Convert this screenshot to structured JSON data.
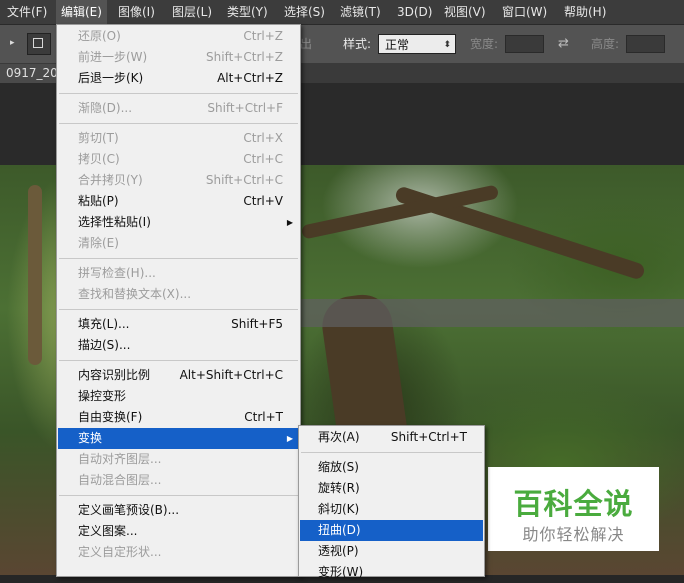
{
  "menubar": {
    "items": [
      "文件(F)",
      "编辑(E)",
      "图像(I)",
      "图层(L)",
      "类型(Y)",
      "选择(S)",
      "滤镜(T)",
      "3D(D)",
      "视图(V)",
      "窗口(W)",
      "帮助(H)"
    ],
    "active": "编辑(E)"
  },
  "options_bar": {
    "partial_label": "出",
    "style_label": "样式:",
    "style_value": "正常",
    "width_label": "宽度:",
    "height_label": "高度:",
    "swap_icon": "swap-arrows-icon"
  },
  "document_tab": {
    "title": "0917_20"
  },
  "edit_menu": {
    "groups": [
      [
        {
          "label": "还原(O)",
          "shortcut": "Ctrl+Z",
          "disabled": true
        },
        {
          "label": "前进一步(W)",
          "shortcut": "Shift+Ctrl+Z",
          "disabled": true
        },
        {
          "label": "后退一步(K)",
          "shortcut": "Alt+Ctrl+Z",
          "disabled": false
        }
      ],
      [
        {
          "label": "渐隐(D)...",
          "shortcut": "Shift+Ctrl+F",
          "disabled": true
        }
      ],
      [
        {
          "label": "剪切(T)",
          "shortcut": "Ctrl+X",
          "disabled": true
        },
        {
          "label": "拷贝(C)",
          "shortcut": "Ctrl+C",
          "disabled": true
        },
        {
          "label": "合并拷贝(Y)",
          "shortcut": "Shift+Ctrl+C",
          "disabled": true
        },
        {
          "label": "粘贴(P)",
          "shortcut": "Ctrl+V",
          "disabled": false
        },
        {
          "label": "选择性粘贴(I)",
          "shortcut": "",
          "disabled": false,
          "submenu": true
        },
        {
          "label": "清除(E)",
          "shortcut": "",
          "disabled": true
        }
      ],
      [
        {
          "label": "拼写检查(H)...",
          "shortcut": "",
          "disabled": true
        },
        {
          "label": "查找和替换文本(X)...",
          "shortcut": "",
          "disabled": true
        }
      ],
      [
        {
          "label": "填充(L)...",
          "shortcut": "Shift+F5",
          "disabled": false
        },
        {
          "label": "描边(S)...",
          "shortcut": "",
          "disabled": false
        }
      ],
      [
        {
          "label": "内容识别比例",
          "shortcut": "Alt+Shift+Ctrl+C",
          "disabled": false
        },
        {
          "label": "操控变形",
          "shortcut": "",
          "disabled": false
        },
        {
          "label": "自由变换(F)",
          "shortcut": "Ctrl+T",
          "disabled": false
        },
        {
          "label": "变换",
          "shortcut": "",
          "disabled": false,
          "submenu": true,
          "highlight": true
        },
        {
          "label": "自动对齐图层...",
          "shortcut": "",
          "disabled": true
        },
        {
          "label": "自动混合图层...",
          "shortcut": "",
          "disabled": true
        }
      ],
      [
        {
          "label": "定义画笔预设(B)...",
          "shortcut": "",
          "disabled": false
        },
        {
          "label": "定义图案...",
          "shortcut": "",
          "disabled": false
        },
        {
          "label": "定义自定形状...",
          "shortcut": "",
          "disabled": true
        }
      ]
    ]
  },
  "transform_submenu": {
    "groups": [
      [
        {
          "label": "再次(A)",
          "shortcut": "Shift+Ctrl+T"
        }
      ],
      [
        {
          "label": "缩放(S)",
          "shortcut": ""
        },
        {
          "label": "旋转(R)",
          "shortcut": ""
        },
        {
          "label": "斜切(K)",
          "shortcut": ""
        },
        {
          "label": "扭曲(D)",
          "shortcut": "",
          "highlight": true
        },
        {
          "label": "透视(P)",
          "shortcut": ""
        },
        {
          "label": "变形(W)",
          "shortcut": ""
        }
      ]
    ]
  },
  "watermark": {
    "title": "百科全说",
    "subtitle": "助你轻松解决",
    "title_color": "#4aab3e"
  },
  "colors": {
    "highlight": "#1560c8",
    "menu_bg": "#f0f0f0",
    "menubar_bg": "#3c3c3c"
  }
}
